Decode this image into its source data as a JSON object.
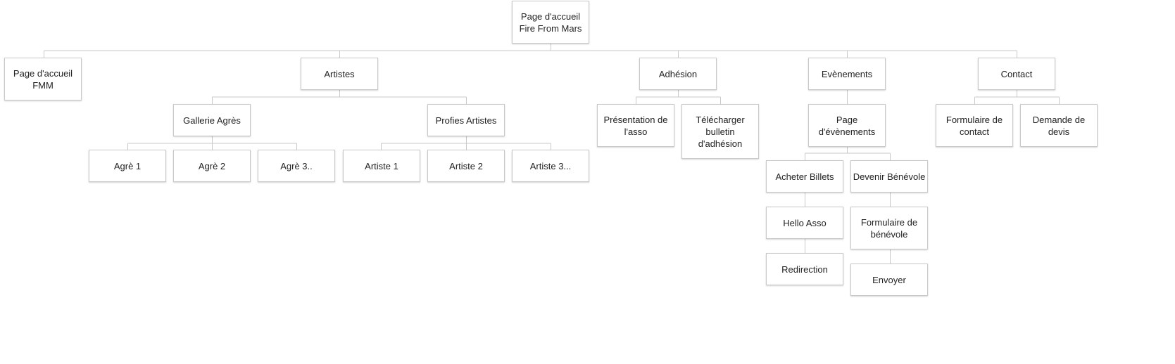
{
  "diagram": {
    "nodes": [
      {
        "id": "root",
        "label": "Page d'accueil Fire From Mars"
      },
      {
        "id": "accueil-fmm",
        "label": "Page d'accueil FMM"
      },
      {
        "id": "artistes",
        "label": "Artistes"
      },
      {
        "id": "adhesion",
        "label": "Adhésion"
      },
      {
        "id": "evenements",
        "label": "Evènements"
      },
      {
        "id": "contact",
        "label": "Contact"
      },
      {
        "id": "gallerie-agres",
        "label": "Gallerie Agrès"
      },
      {
        "id": "profies-artistes",
        "label": "Profies Artistes"
      },
      {
        "id": "agre-1",
        "label": "Agrè 1"
      },
      {
        "id": "agre-2",
        "label": "Agrè 2"
      },
      {
        "id": "agre-3",
        "label": "Agrè 3.."
      },
      {
        "id": "artiste-1",
        "label": "Artiste 1"
      },
      {
        "id": "artiste-2",
        "label": "Artiste 2"
      },
      {
        "id": "artiste-3",
        "label": "Artiste 3..."
      },
      {
        "id": "presentation-asso",
        "label": "Présentation de l'asso"
      },
      {
        "id": "telecharger-bulletin",
        "label": "Télécharger bulletin d'adhésion"
      },
      {
        "id": "page-evenements",
        "label": "Page d'évènements"
      },
      {
        "id": "acheter-billets",
        "label": "Acheter Billets"
      },
      {
        "id": "devenir-benevole",
        "label": "Devenir Bénévole"
      },
      {
        "id": "hello-asso",
        "label": "Hello Asso"
      },
      {
        "id": "formulaire-benevole",
        "label": "Formulaire de bénévole"
      },
      {
        "id": "redirection",
        "label": "Redirection"
      },
      {
        "id": "envoyer",
        "label": "Envoyer"
      },
      {
        "id": "formulaire-contact",
        "label": "Formulaire de contact"
      },
      {
        "id": "demande-devis",
        "label": "Demande de devis"
      }
    ]
  },
  "colors": {
    "node_border": "#c9c9c9",
    "connector": "#c9c9c9",
    "text": "#222222"
  }
}
